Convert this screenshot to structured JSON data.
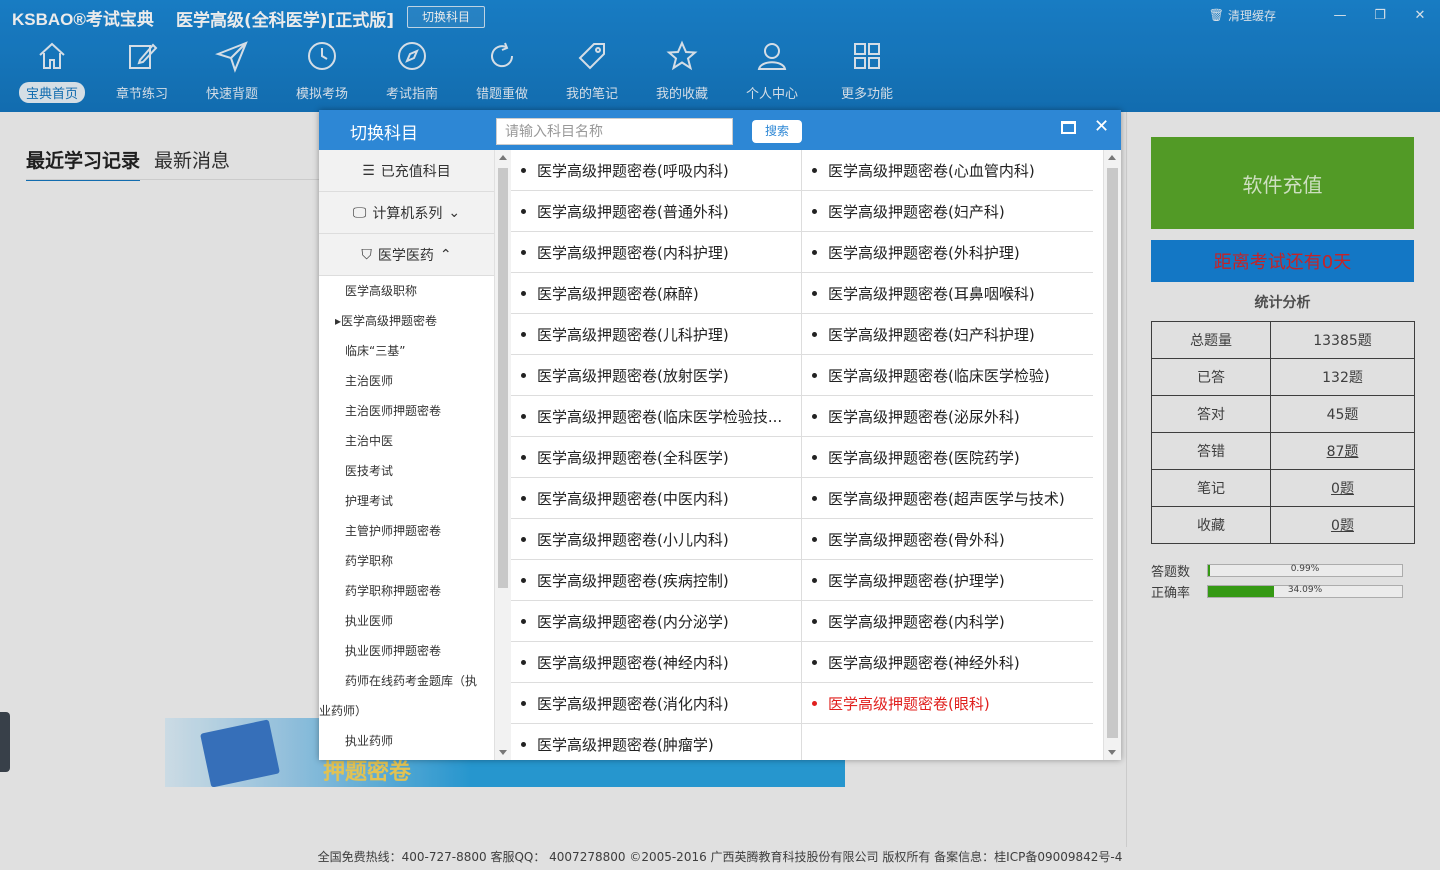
{
  "header": {
    "logo": "KSBAO®考试宝典",
    "title": "医学高级(全科医学)[正式版]",
    "switch_label": "切换科目",
    "clear_cache": "清理缓存"
  },
  "nav": [
    {
      "label": "宝典首页",
      "icon": "home-icon"
    },
    {
      "label": "章节练习",
      "icon": "edit-icon"
    },
    {
      "label": "快速背题",
      "icon": "send-icon"
    },
    {
      "label": "模拟考场",
      "icon": "clock-icon"
    },
    {
      "label": "考试指南",
      "icon": "compass-icon"
    },
    {
      "label": "错题重做",
      "icon": "redo-icon"
    },
    {
      "label": "我的笔记",
      "icon": "tag-icon"
    },
    {
      "label": "我的收藏",
      "icon": "star-icon"
    },
    {
      "label": "个人中心",
      "icon": "user-icon"
    },
    {
      "label": "更多功能",
      "icon": "grid-icon"
    }
  ],
  "tabs": [
    "最近学习记录",
    "最新消息"
  ],
  "banner": {
    "text": "押题密卷"
  },
  "right": {
    "recharge": "软件充值",
    "countdown": "距离考试还有0天",
    "stats_title": "统计分析",
    "stats": [
      {
        "label": "总题量",
        "value": "13385题"
      },
      {
        "label": "已答",
        "value": "132题"
      },
      {
        "label": "答对",
        "value": "45题"
      },
      {
        "label": "答错",
        "value": "87题"
      },
      {
        "label": "笔记",
        "value": "0题"
      },
      {
        "label": "收藏",
        "value": "0题"
      }
    ],
    "answered_label": "答题数",
    "answered_pct": "0.99%",
    "answered_fraction": 0.0099,
    "accuracy_label": "正确率",
    "accuracy_pct": "34.09%",
    "accuracy_fraction": 0.3409
  },
  "footer": "全国免费热线：400-727-8800  客服QQ： 4007278800  ©2005-2016 广西英腾教育科技股份有限公司 版权所有  备案信息：桂ICP备09009842号-4",
  "dialog": {
    "title": "切换科目",
    "search_placeholder": "请输入科目名称",
    "search_button": "搜索",
    "side_groups": [
      "已充值科目",
      "计算机系列",
      "医学医药"
    ],
    "side_items": [
      "医学高级职称",
      "▸医学高级押题密卷",
      "临床“三基”",
      "主治医师",
      "主治医师押题密卷",
      "主治中医",
      "医技考试",
      "护理考试",
      "主管护师押题密卷",
      "药学职称",
      "药学职称押题密卷",
      "执业医师",
      "执业医师押题密卷",
      "药师在线药考金题库（执",
      "业药师）",
      "执业药师"
    ],
    "grid": [
      [
        "医学高级押题密卷(呼吸内科)",
        "医学高级押题密卷(心血管内科)"
      ],
      [
        "医学高级押题密卷(普通外科)",
        "医学高级押题密卷(妇产科)"
      ],
      [
        "医学高级押题密卷(内科护理)",
        "医学高级押题密卷(外科护理)"
      ],
      [
        "医学高级押题密卷(麻醉)",
        "医学高级押题密卷(耳鼻咽喉科)"
      ],
      [
        "医学高级押题密卷(儿科护理)",
        "医学高级押题密卷(妇产科护理)"
      ],
      [
        "医学高级押题密卷(放射医学)",
        "医学高级押题密卷(临床医学检验)"
      ],
      [
        "医学高级押题密卷(临床医学检验技...",
        "医学高级押题密卷(泌尿外科)"
      ],
      [
        "医学高级押题密卷(全科医学)",
        "医学高级押题密卷(医院药学)"
      ],
      [
        "医学高级押题密卷(中医内科)",
        "医学高级押题密卷(超声医学与技术)"
      ],
      [
        "医学高级押题密卷(小儿内科)",
        "医学高级押题密卷(骨外科)"
      ],
      [
        "医学高级押题密卷(疾病控制)",
        "医学高级押题密卷(护理学)"
      ],
      [
        "医学高级押题密卷(内分泌学)",
        "医学高级押题密卷(内科学)"
      ],
      [
        "医学高级押题密卷(神经内科)",
        "医学高级押题密卷(神经外科)"
      ],
      [
        "医学高级押题密卷(消化内科)",
        "医学高级押题密卷(眼科)"
      ],
      [
        "医学高级押题密卷(肿瘤学)",
        ""
      ]
    ]
  }
}
